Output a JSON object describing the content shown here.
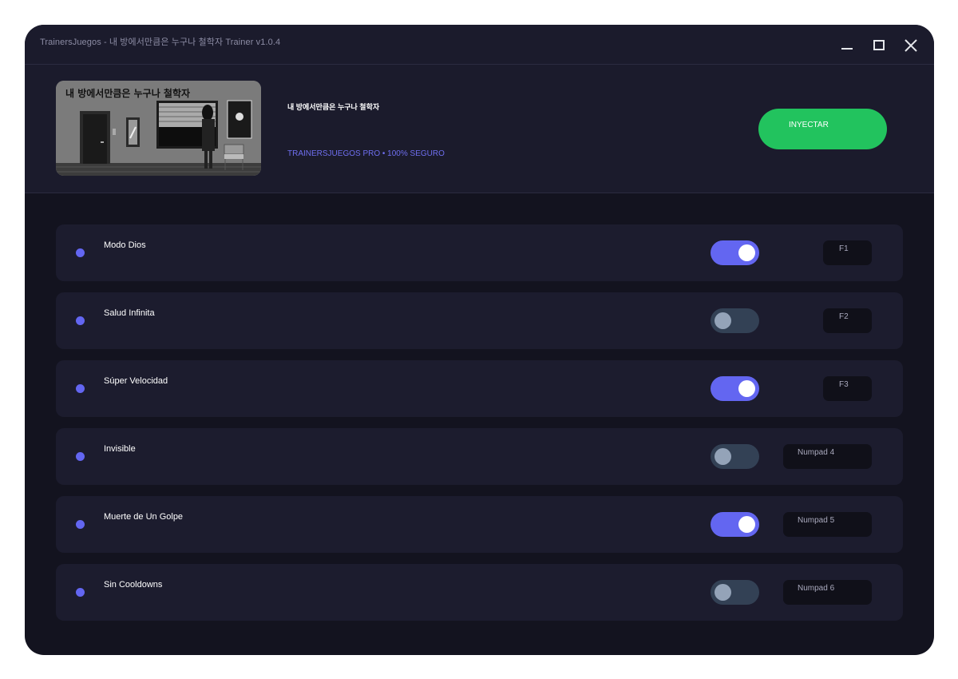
{
  "window": {
    "title": "TrainersJuegos - 내 방에서만큼은 누구나 철학자 Trainer v1.0.4"
  },
  "header": {
    "art_caption": "내 방에서만큼은 누구나 철학자",
    "game_name": "내 방에서만큼은 누구나 철학자",
    "brand_line": "TRAINERSJUEGOS PRO • 100% SEGURO",
    "inject_label": "INYECTAR",
    "inject_color": "#22c35e"
  },
  "colors": {
    "accent": "#6366f1",
    "toggle_off": "#334155"
  },
  "cheats": [
    {
      "name": "Modo Dios",
      "enabled": true,
      "hotkey": "F1"
    },
    {
      "name": "Salud Infinita",
      "enabled": false,
      "hotkey": "F2"
    },
    {
      "name": "Súper Velocidad",
      "enabled": true,
      "hotkey": "F3"
    },
    {
      "name": "Invisible",
      "enabled": false,
      "hotkey": "Numpad 4"
    },
    {
      "name": "Muerte de Un Golpe",
      "enabled": true,
      "hotkey": "Numpad 5"
    },
    {
      "name": "Sin Cooldowns",
      "enabled": false,
      "hotkey": "Numpad 6"
    }
  ]
}
